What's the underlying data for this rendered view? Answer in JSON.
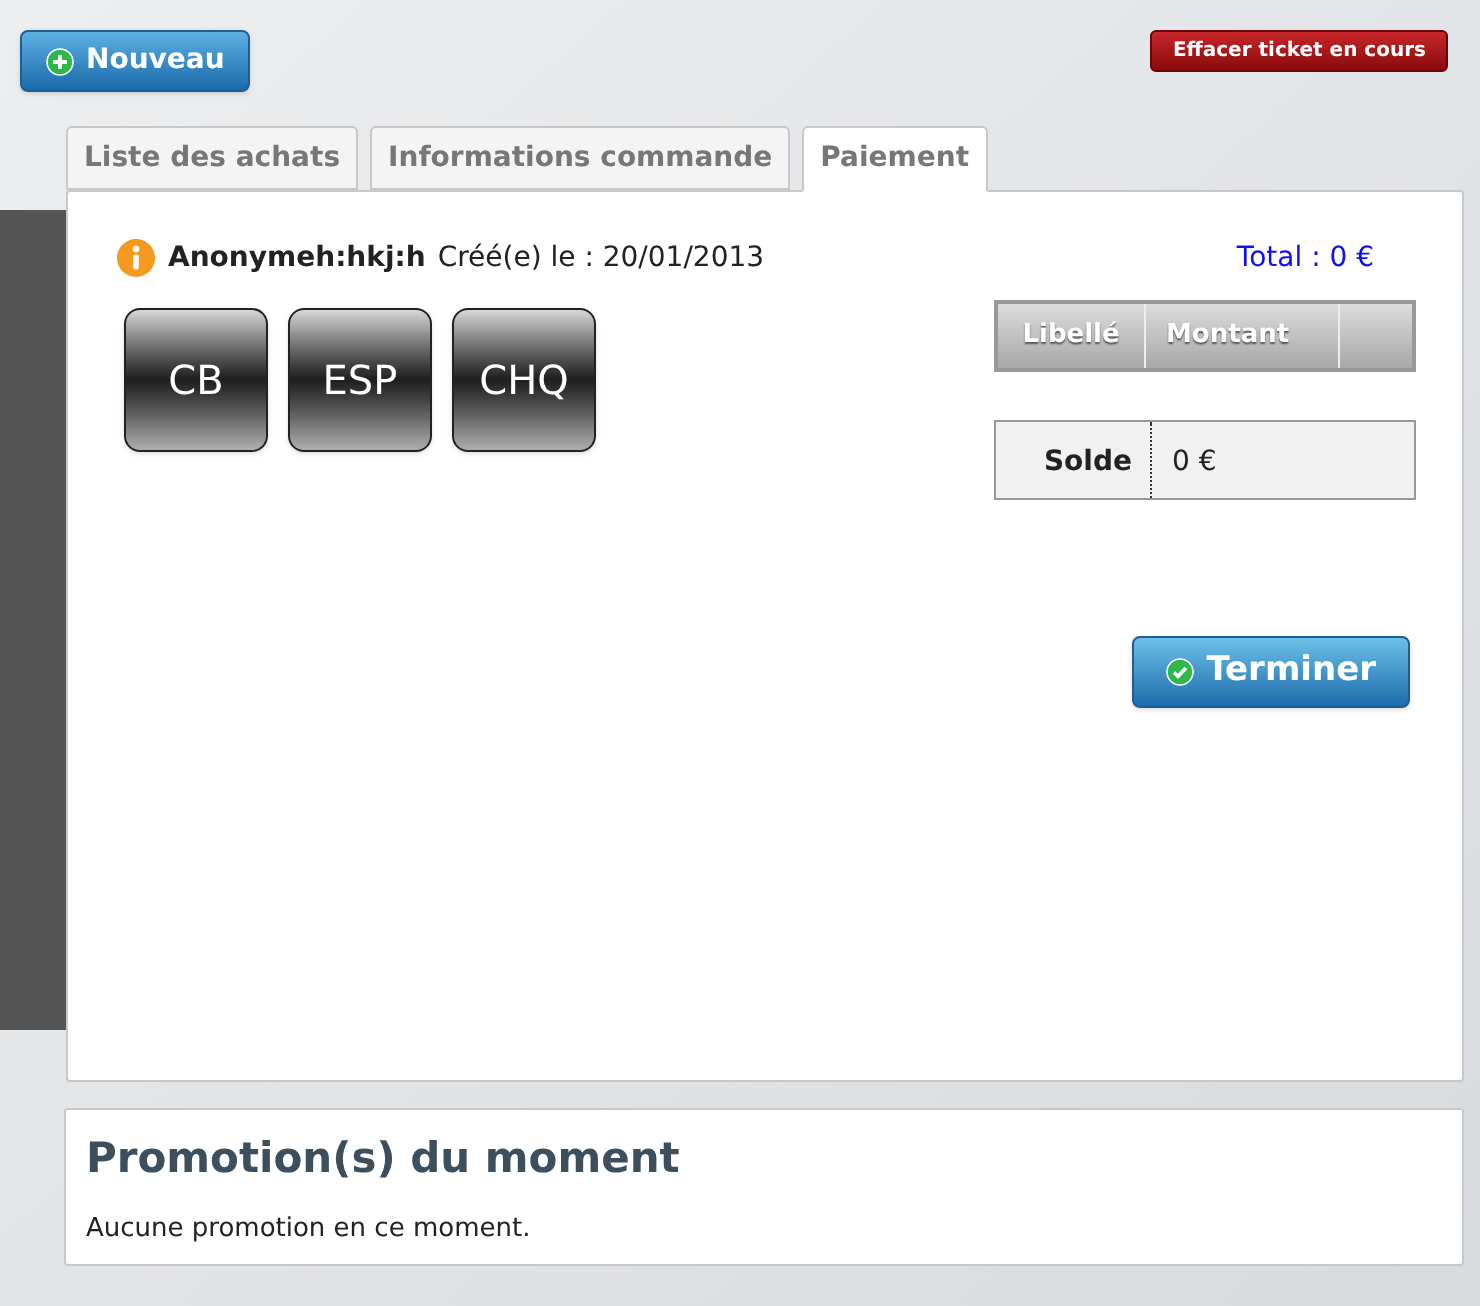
{
  "toolbar": {
    "new_button": "Nouveau",
    "clear_button": "Effacer ticket en cours"
  },
  "tabs": [
    {
      "label": "Liste des achats",
      "selected": false
    },
    {
      "label": "Informations commande",
      "selected": false
    },
    {
      "label": "Paiement",
      "selected": true
    }
  ],
  "order": {
    "customer": "Anonymeh:hkj:h",
    "created": "Créé(e) le : 20/01/2013",
    "total": "Total : 0 €"
  },
  "payment_methods": [
    "CB",
    "ESP",
    "CHQ"
  ],
  "payments_table": {
    "columns": [
      "Libellé",
      "Montant"
    ]
  },
  "balance": {
    "label": "Solde",
    "value": "0 €"
  },
  "finish_button": "Terminer",
  "promotions": {
    "title": "Promotion(s) du moment",
    "message": "Aucune promotion en ce moment."
  }
}
